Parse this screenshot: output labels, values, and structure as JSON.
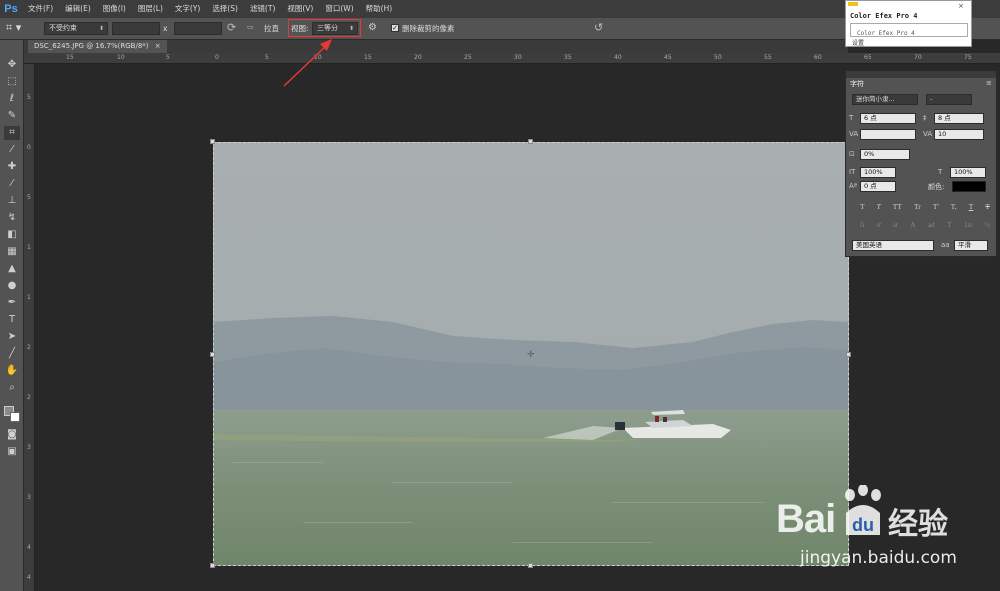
{
  "app": {
    "logo": "Ps"
  },
  "menu": [
    "文件(F)",
    "编辑(E)",
    "图像(I)",
    "图层(L)",
    "文字(Y)",
    "选择(S)",
    "滤镜(T)",
    "视图(V)",
    "窗口(W)",
    "帮助(H)"
  ],
  "options": {
    "ratio_preset": "不受约束",
    "width_value": "",
    "height_value": "",
    "x_sep": "x",
    "straighten_label": "拉直",
    "view_label": "视图:",
    "view_value": "三等分",
    "delete_pixels_label": "删除裁剪的像素",
    "delete_pixels_checked": true
  },
  "document": {
    "tab_title": "DSC_6245.JPG @ 16.7%(RGB/8*)",
    "close": "×"
  },
  "ruler_top_labels": [
    "15",
    "10",
    "5",
    "0",
    "5",
    "10",
    "15",
    "20",
    "25",
    "30",
    "35",
    "40",
    "45",
    "50",
    "55",
    "60",
    "65",
    "70",
    "75"
  ],
  "ruler_left_labels": [
    "5",
    "0",
    "5",
    "1",
    "1",
    "2",
    "2",
    "3",
    "3",
    "4",
    "4"
  ],
  "color_efex_panel": {
    "title": "Color Efex Pro 4",
    "subtitle": "Color Efex Pro 4",
    "footer": "设置"
  },
  "character_panel": {
    "tab": "字符",
    "font_family": "迷你简小隶...",
    "font_style": "-",
    "font_size": "6 点",
    "leading": "8 点",
    "kerning": "",
    "tracking": "10",
    "scale_pct": "0%",
    "vertical_scale": "100%",
    "horizontal_scale": "100%",
    "baseline_shift": "0 点",
    "color_label": "颜色:",
    "text_color": "#000000",
    "style_buttons": [
      "T",
      "T",
      "TT",
      "Tr",
      "T'",
      "T,",
      "T",
      "T"
    ],
    "opentype_buttons": [
      "fi",
      "ơ",
      "st",
      "A",
      "ad",
      "T",
      "1st",
      "½"
    ],
    "language": "美国英语",
    "aa_label": "aa",
    "antialias": "平滑"
  },
  "watermark": {
    "brand_left": "Bai",
    "brand_right": "经验",
    "url": "jingyan.baidu.com"
  },
  "colors": {
    "accent_red": "#e53935",
    "ps_blue": "#4fa6ff"
  }
}
